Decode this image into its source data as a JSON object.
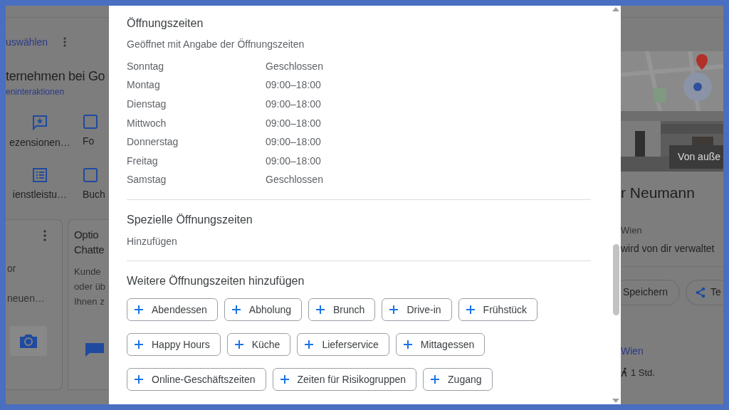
{
  "background_left": {
    "header_text": "uswählen",
    "heading": "ternehmen bei Go",
    "link": "eninteraktionen",
    "shortcuts": [
      {
        "label": "ezensionen…"
      },
      {
        "label": "Fo"
      },
      {
        "label": "ienstleistu…"
      },
      {
        "label": "Buch"
      }
    ],
    "card_1": {
      "lines": [
        "or",
        "neuen…"
      ]
    },
    "card_2": {
      "title_lines": [
        "Optio",
        "Chatte"
      ],
      "body_lines": [
        "Kunde",
        "oder üb",
        "Ihnen z"
      ]
    }
  },
  "dialog": {
    "title": "Öffnungszeiten",
    "status": "Geöffnet mit Angabe der Öffnungszeiten",
    "hours": [
      {
        "day": "Sonntag",
        "time": "Geschlossen"
      },
      {
        "day": "Montag",
        "time": "09:00–18:00"
      },
      {
        "day": "Dienstag",
        "time": "09:00–18:00"
      },
      {
        "day": "Mittwoch",
        "time": "09:00–18:00"
      },
      {
        "day": "Donnerstag",
        "time": "09:00–18:00"
      },
      {
        "day": "Freitag",
        "time": "09:00–18:00"
      },
      {
        "day": "Samstag",
        "time": "Geschlossen"
      }
    ],
    "special_title": "Spezielle Öffnungszeiten",
    "special_action": "Hinzufügen",
    "more_title": "Weitere Öffnungszeiten hinzufügen",
    "chip_rows": [
      [
        "Abendessen",
        "Abholung",
        "Brunch",
        "Drive-in",
        "Frühstück"
      ],
      [
        "Happy Hours",
        "Küche",
        "Lieferservice",
        "Mittagessen"
      ],
      [
        "Online-Geschäftszeiten",
        "Zeiten für Risikogruppen",
        "Zugang"
      ]
    ]
  },
  "background_right": {
    "photo_label": "Von auße",
    "name": "r Neumann",
    "address": "Wien",
    "managed": "wird von dir verwaltet",
    "actions": [
      "Speichern",
      "Te"
    ],
    "link": "Wien",
    "travel_time": "1 Std."
  }
}
